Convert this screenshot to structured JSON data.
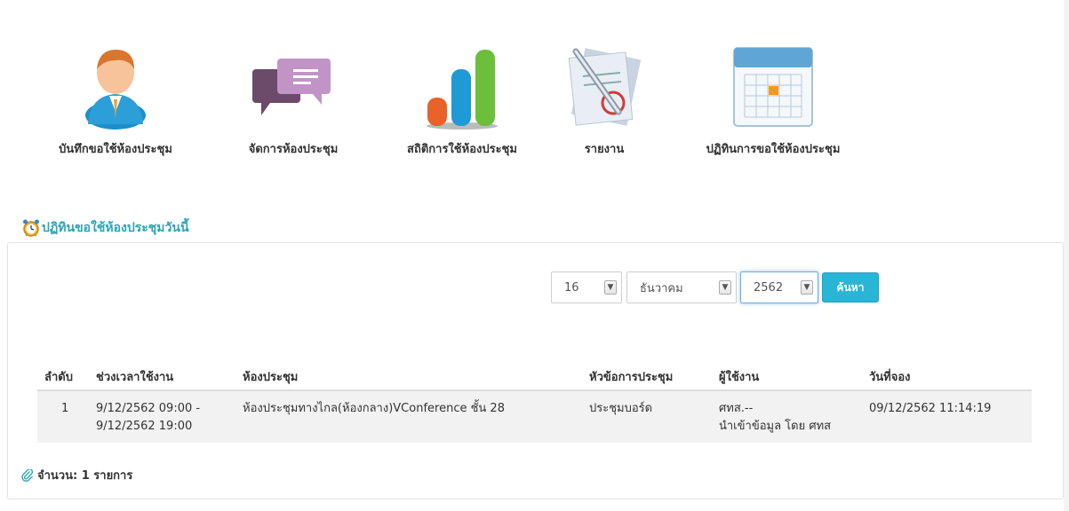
{
  "menu": [
    {
      "label": "บันทึกขอใช้ห้องประชุม",
      "icon": "user-icon"
    },
    {
      "label": "จัดการห้องประชุม",
      "icon": "chat-bubbles-icon"
    },
    {
      "label": "สถิติการใช้ห้องประชุม",
      "icon": "bar-chart-icon"
    },
    {
      "label": "รายงาน",
      "icon": "document-pen-icon"
    },
    {
      "label": "ปฏิทินการขอใช้ห้องประชุม",
      "icon": "calendar-icon"
    }
  ],
  "section": {
    "title": "ปฏิทินขอใช้ห้องประชุมวันนี้",
    "icon": "alarm-clock-icon"
  },
  "filter": {
    "day": "16",
    "month": "ธันวาคม",
    "year": "2562",
    "search_label": "ค้นหา"
  },
  "table": {
    "headers": [
      "ลำดับ",
      "ช่วงเวลาใช้งาน",
      "ห้องประชุม",
      "หัวข้อการประชุม",
      "ผู้ใช้งาน",
      "วันที่จอง"
    ],
    "rows": [
      {
        "no": "1",
        "time_start": "9/12/2562 09:00 -",
        "time_end": "9/12/2562 19:00",
        "room": "ห้องประชุมทางไกล(ห้องกลาง)VConference ชั้น 28",
        "topic": "ประชุมบอร์ด",
        "user": "ศทส.--",
        "user_note": "นำเข้าข้อมูล โดย ศทส",
        "booked_at": "09/12/2562 11:14:19"
      }
    ]
  },
  "footer": {
    "count_label": "จำนวน: 1 รายการ",
    "icon": "paperclip-icon"
  },
  "colors": {
    "accent": "#29b5d6",
    "title": "#2aa6b6",
    "row_bg": "#f2f2f2"
  }
}
